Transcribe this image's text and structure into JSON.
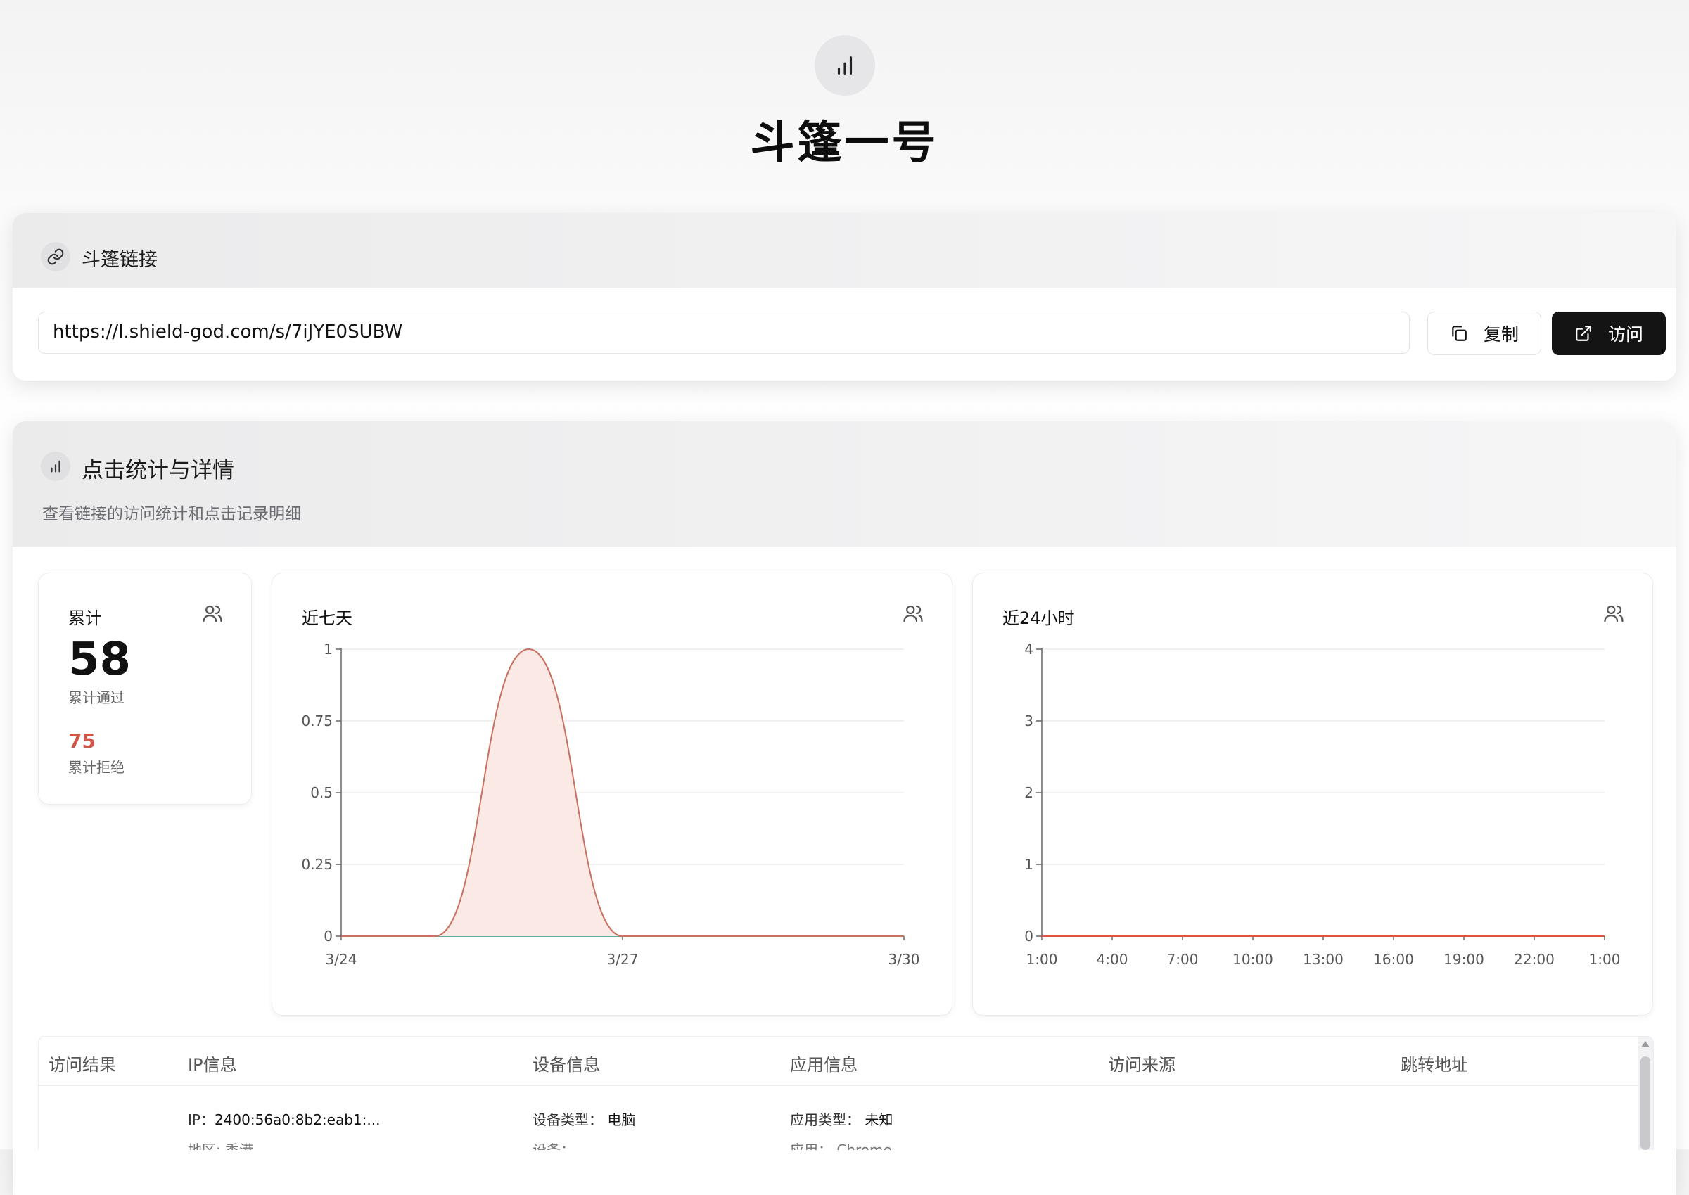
{
  "page": {
    "title": "斗篷一号",
    "icon": "bar-chart-icon"
  },
  "link_card": {
    "title": "斗篷链接",
    "icon": "link-icon",
    "url": "https://l.shield-god.com/s/7iJYE0SUBW",
    "copy_label": "复制",
    "visit_label": "访问"
  },
  "stats_card": {
    "title": "点击统计与详情",
    "subtitle": "查看链接的访问统计和点击记录明细",
    "total": {
      "label": "累计",
      "passed": "58",
      "passed_label": "累计通过",
      "rejected": "75",
      "rejected_label": "累计拒绝"
    },
    "week_title": "近七天",
    "day_title": "近24小时"
  },
  "chart_data": [
    {
      "type": "area",
      "title": "近七天",
      "x": [
        "3/24",
        "3/25",
        "3/26",
        "3/27",
        "3/28",
        "3/29",
        "3/30"
      ],
      "x_tick_labels": [
        "3/24",
        "3/27",
        "3/30"
      ],
      "y_tick_labels": [
        "0",
        "0.25",
        "0.5",
        "0.75",
        "1"
      ],
      "ylim": [
        0,
        1
      ],
      "grid": true,
      "series": [
        {
          "values": [
            0,
            0,
            1,
            0,
            0,
            0,
            0
          ],
          "color": "#c9705f",
          "fill": "#fbe9e6"
        },
        {
          "values": [
            0,
            0,
            0,
            0,
            0,
            0,
            0
          ],
          "color": "#5aa9a4"
        }
      ]
    },
    {
      "type": "line",
      "title": "近24小时",
      "x_tick_labels": [
        "1:00",
        "4:00",
        "7:00",
        "10:00",
        "13:00",
        "16:00",
        "19:00",
        "22:00",
        "1:00"
      ],
      "y_tick_labels": [
        "0",
        "1",
        "2",
        "3",
        "4"
      ],
      "ylim": [
        0,
        4
      ],
      "grid": true,
      "series": [
        {
          "values": [
            0,
            0,
            0,
            0,
            0,
            0,
            0,
            0,
            0,
            0,
            0,
            0,
            0,
            0,
            0,
            0,
            0,
            0,
            0,
            0,
            0,
            0,
            0,
            0,
            0
          ],
          "color": "#e0533f"
        }
      ]
    }
  ],
  "table": {
    "headers": [
      "访问结果",
      "IP信息",
      "设备信息",
      "应用信息",
      "访问来源",
      "跳转地址"
    ],
    "row": {
      "ip_label": "IP：",
      "ip": "2400:56a0:8b2:eab1:...",
      "region_label": "地区:",
      "region": "香港",
      "device_type_label": "设备类型：",
      "device_type": "电脑",
      "device_label": "设备：",
      "device": "-",
      "app_type_label": "应用类型：",
      "app_type": "未知",
      "app_label": "应用：",
      "app": "Chrome"
    }
  }
}
